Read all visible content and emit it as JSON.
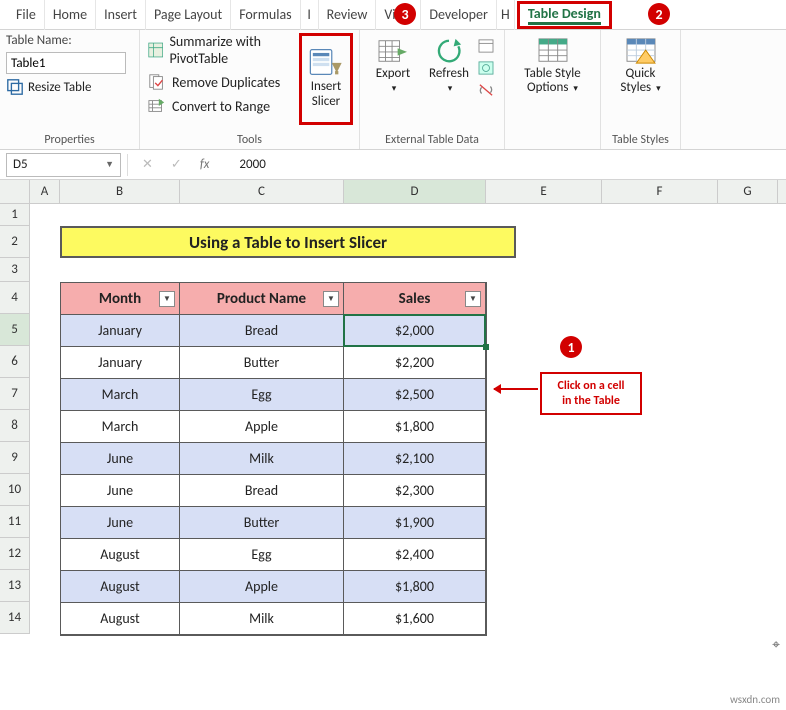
{
  "ribbon": {
    "tabs": [
      "File",
      "Home",
      "Insert",
      "Page Layout",
      "Formulas",
      "I",
      "Review",
      "View",
      "Developer",
      "H",
      "Table Design"
    ],
    "table_design_label": "Table Design"
  },
  "properties": {
    "label": "Properties",
    "table_name_label": "Table Name:",
    "table_name_value": "Table1",
    "resize_label": "Resize Table"
  },
  "tools": {
    "label": "Tools",
    "summarize": "Summarize with PivotTable",
    "remove_dup": "Remove Duplicates",
    "convert": "Convert to Range",
    "insert_slicer_l1": "Insert",
    "insert_slicer_l2": "Slicer"
  },
  "external": {
    "label": "External Table Data",
    "export": "Export",
    "refresh": "Refresh"
  },
  "styleopts": {
    "l1": "Table Style",
    "l2": "Options"
  },
  "tstyles": {
    "label": "Table Styles",
    "l1": "Quick",
    "l2": "Styles"
  },
  "fbar": {
    "namebox": "D5",
    "formula": "2000"
  },
  "columns": [
    "A",
    "B",
    "C",
    "D",
    "E",
    "F",
    "G"
  ],
  "rows": [
    "1",
    "2",
    "3",
    "4",
    "5",
    "6",
    "7",
    "8",
    "9",
    "10",
    "11",
    "12",
    "13",
    "14"
  ],
  "title": "Using a Table to Insert Slicer",
  "headers": {
    "month": "Month",
    "prod": "Product Name",
    "sales": "Sales"
  },
  "data": [
    {
      "month": "January",
      "prod": "Bread",
      "sales": "$2,000"
    },
    {
      "month": "January",
      "prod": "Butter",
      "sales": "$2,200"
    },
    {
      "month": "March",
      "prod": "Egg",
      "sales": "$2,500"
    },
    {
      "month": "March",
      "prod": "Apple",
      "sales": "$1,800"
    },
    {
      "month": "June",
      "prod": "Milk",
      "sales": "$2,100"
    },
    {
      "month": "June",
      "prod": "Bread",
      "sales": "$2,300"
    },
    {
      "month": "June",
      "prod": "Butter",
      "sales": "$1,900"
    },
    {
      "month": "August",
      "prod": "Egg",
      "sales": "$2,400"
    },
    {
      "month": "August",
      "prod": "Apple",
      "sales": "$1,800"
    },
    {
      "month": "August",
      "prod": "Milk",
      "sales": "$1,600"
    }
  ],
  "annotations": {
    "n1": "1",
    "n2": "2",
    "n3": "3",
    "callout_l1": "Click on a cell",
    "callout_l2": "in the Table"
  },
  "watermark": "wsxdn.com"
}
